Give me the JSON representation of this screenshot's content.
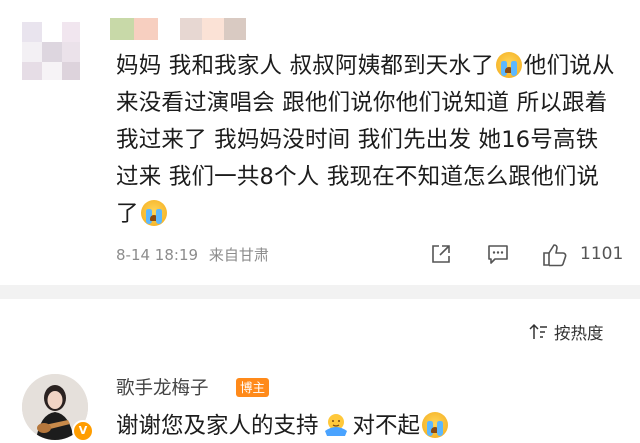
{
  "comment": {
    "text_1": "妈妈 我和我家人 叔叔阿姨都到天水了",
    "text_2": "他们说从来没看过演唱会 跟他们说你他们说知道 所以跟着我过来了 我妈妈没时间 我们先出发 她16号高铁过来 我们一共8个人 我现在不知道怎么跟他们说了",
    "emoji": "crying-face",
    "date": "8-14 18:19",
    "location": "来自甘肃",
    "like_count": "1101"
  },
  "sort": {
    "label": "按热度"
  },
  "reply": {
    "author_name": "歌手龙梅子",
    "author_tag": "博主",
    "text_1": "谢谢您及家人的支持",
    "text_2": "对不起",
    "verified_badge": "V"
  },
  "colors": {
    "meta_gray": "#8c8c8c",
    "tag_orange": "#ff8a1a",
    "divider": "#f2f2f2"
  }
}
